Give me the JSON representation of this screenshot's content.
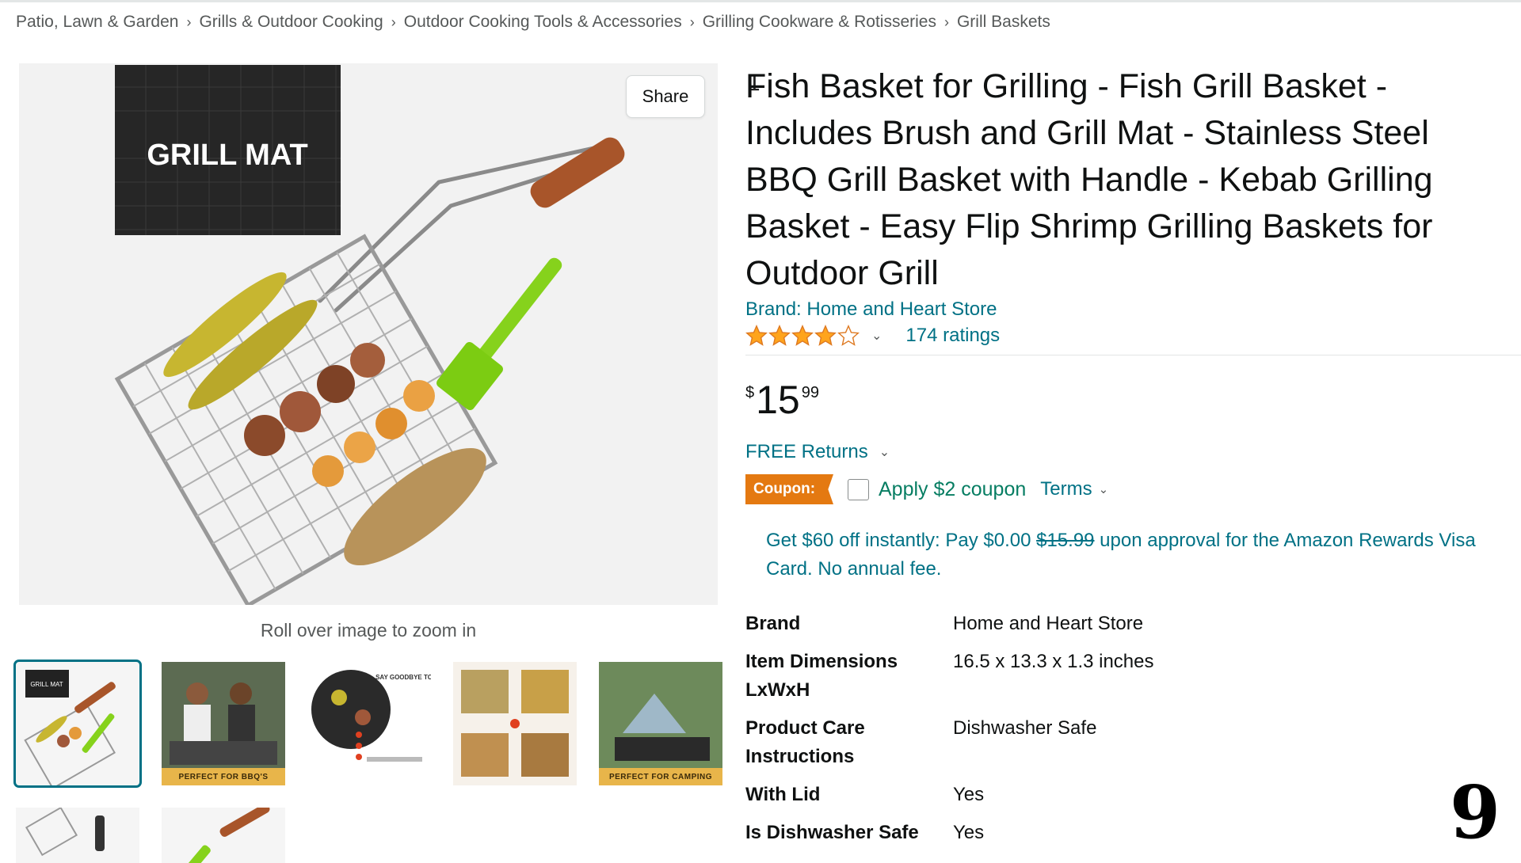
{
  "breadcrumb": [
    "Patio, Lawn & Garden",
    "Grills & Outdoor Cooking",
    "Outdoor Cooking Tools & Accessories",
    "Grilling Cookware & Rotisseries",
    "Grill Baskets"
  ],
  "breadcrumb_separator": "›",
  "gallery": {
    "share_label": "Share",
    "main_image_text": "GRILL MAT",
    "zoom_hint": "Roll over image to zoom in",
    "thumbnail_captions": [
      "PERFECT FOR BBQ'S",
      "PERFECT FOR CAMPING"
    ],
    "thumbnail_small_text": [
      "GRILL MAT",
      "SAY GOODBYE TO"
    ]
  },
  "product": {
    "title": "Fish Basket for Grilling - Fish Grill Basket - Includes Brush and Grill Mat - Stainless Steel BBQ Grill Basket with Handle - Kebab Grilling Basket - Easy Flip Shrimp Grilling Baskets for Outdoor Grill",
    "brand_link": "Brand: Home and Heart Store",
    "rating": 4,
    "rating_max": 5,
    "ratings_count": "174 ratings",
    "price_symbol": "$",
    "price_whole": "15",
    "price_fraction": "99",
    "free_returns": "FREE Returns",
    "coupon_badge": "Coupon:",
    "coupon_label": "Apply $2 coupon",
    "terms_label": "Terms",
    "promo_prefix": "Get $60 off instantly: Pay $0.00 ",
    "promo_strike": "$15.99",
    "promo_suffix": " upon approval for the Amazon Rewards Visa Card. No annual fee."
  },
  "specs": [
    {
      "key": "Brand",
      "value": "Home and Heart Store"
    },
    {
      "key": "Item Dimensions LxWxH",
      "value": "16.5 x 13.3 x 1.3 inches"
    },
    {
      "key": "Product Care Instructions",
      "value": "Dishwasher Safe"
    },
    {
      "key": "With Lid",
      "value": "Yes"
    },
    {
      "key": "Is Dishwasher Safe",
      "value": "Yes"
    }
  ],
  "overlay": {
    "slide_number": "9"
  },
  "colors": {
    "link": "#007185",
    "coupon": "#e47911",
    "coupon_text": "#067d62",
    "star": "#ffa41c",
    "selected_thumb": "#007185"
  },
  "icons": [
    "star-icon",
    "chevron-down-icon",
    "checkbox-icon"
  ]
}
